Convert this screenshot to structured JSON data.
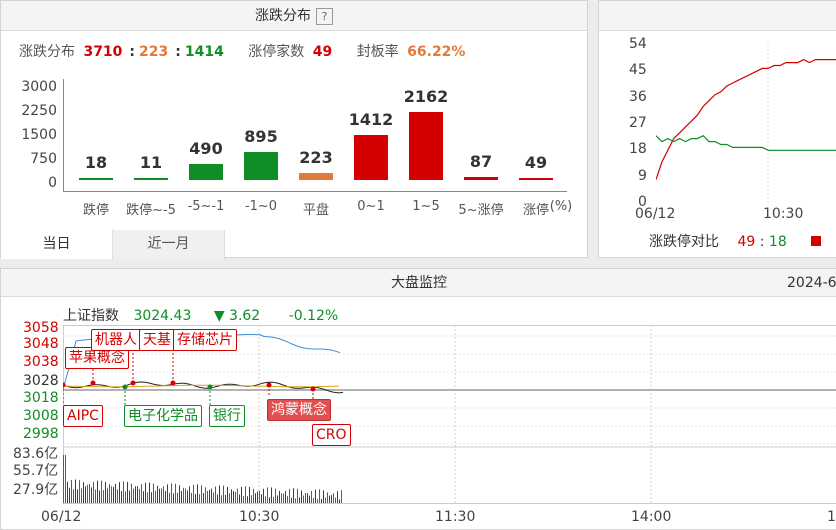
{
  "distribution": {
    "title": "涨跌分布",
    "help": "?",
    "summary": {
      "label": "涨跌分布",
      "up": "3710",
      "flat": "223",
      "down": "1414",
      "limitup_label": "涨停家数",
      "limitup": "49",
      "sealrate_label": "封板率",
      "sealrate": "66.22%"
    },
    "unit": "(%)",
    "chart_data": {
      "type": "bar",
      "categories": [
        "跌停",
        "跌停~-5",
        "-5~-1",
        "-1~0",
        "平盘",
        "0~1",
        "1~5",
        "5~涨停",
        "涨停"
      ],
      "values": [
        18,
        11,
        490,
        895,
        223,
        1412,
        2162,
        87,
        49
      ],
      "yticks": [
        "3000",
        "2250",
        "1500",
        "750",
        "0"
      ],
      "ylim": [
        0,
        3000
      ]
    },
    "colors": {
      "up": "#d40000",
      "down": "#0f8d26",
      "flat": "#e07b39"
    },
    "tabs": [
      "当日",
      "近一月"
    ]
  },
  "ratio": {
    "label": "涨跌停对比",
    "value_up": "49",
    "value_sep": ":",
    "value_down": "18",
    "yticks": [
      "54",
      "45",
      "36",
      "27",
      "18",
      "9",
      "0"
    ],
    "xticks": [
      "06/12",
      "10:30"
    ],
    "chart_data": {
      "type": "line",
      "ylim": [
        0,
        54
      ],
      "series": [
        {
          "color": "#d40000",
          "values": [
            8,
            14,
            18,
            22,
            24,
            26,
            28,
            30,
            33,
            35,
            37,
            38,
            40,
            41,
            42,
            43,
            44,
            45,
            46,
            46,
            47,
            47,
            48,
            48,
            48,
            49,
            48,
            49,
            49,
            49,
            49,
            49
          ]
        },
        {
          "color": "#0f8d26",
          "values": [
            23,
            21,
            22,
            21,
            22,
            21,
            22,
            22,
            23,
            21,
            21,
            20,
            20,
            19,
            19,
            19,
            19,
            19,
            19,
            18,
            18,
            18,
            18,
            18,
            18,
            18,
            18,
            18,
            18,
            18,
            18,
            18
          ]
        }
      ]
    }
  },
  "monitor": {
    "title": "大盘监控",
    "date": "2024-6",
    "index_name": "上证指数",
    "index_value": "3024.43",
    "change_arrow": "▼",
    "change": "3.62",
    "change_pct": "-0.12%",
    "yticks_up": [
      "3058",
      "3048",
      "3038"
    ],
    "ytick_mid": "3028",
    "yticks_down": [
      "3018",
      "3008",
      "2998"
    ],
    "vol_ticks": [
      "83.6亿",
      "55.7亿",
      "27.9亿"
    ],
    "xticks": [
      "06/12",
      "10:30",
      "11:30",
      "14:00",
      "1"
    ],
    "annotations": [
      "苹果概念",
      "机器人",
      "天基",
      "存储芯片",
      "AIPC",
      "电子化学品",
      "银行",
      "鸿蒙概念",
      "CRO"
    ]
  }
}
